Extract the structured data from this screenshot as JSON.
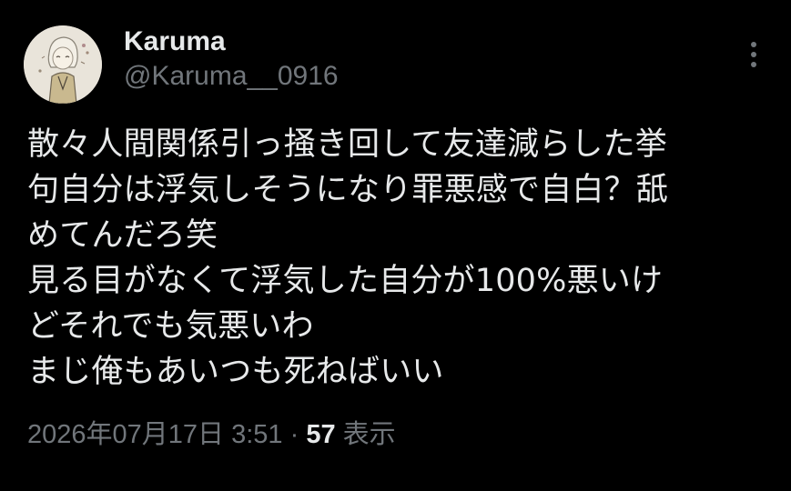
{
  "author": {
    "display_name": "Karuma",
    "handle": "@Karuma__0916"
  },
  "tweet": {
    "lines": [
      "散々人間関係引っ掻き回して友達減らした挙",
      "句自分は浮気しそうになり罪悪感で自白？舐",
      "めてんだろ笑",
      "見る目がなくて浮気した自分が100%悪いけ",
      "どそれでも気悪いわ",
      "まじ俺もあいつも死ねばいい"
    ]
  },
  "meta": {
    "timestamp": "2026年07月17日 3:51",
    "separator": "·",
    "views_count": "57",
    "views_label": "表示"
  },
  "icons": {
    "more": "more-vertical-icon"
  },
  "colors": {
    "background": "#000000",
    "primary_text": "#e7e9ea",
    "secondary_text": "#71767b"
  }
}
